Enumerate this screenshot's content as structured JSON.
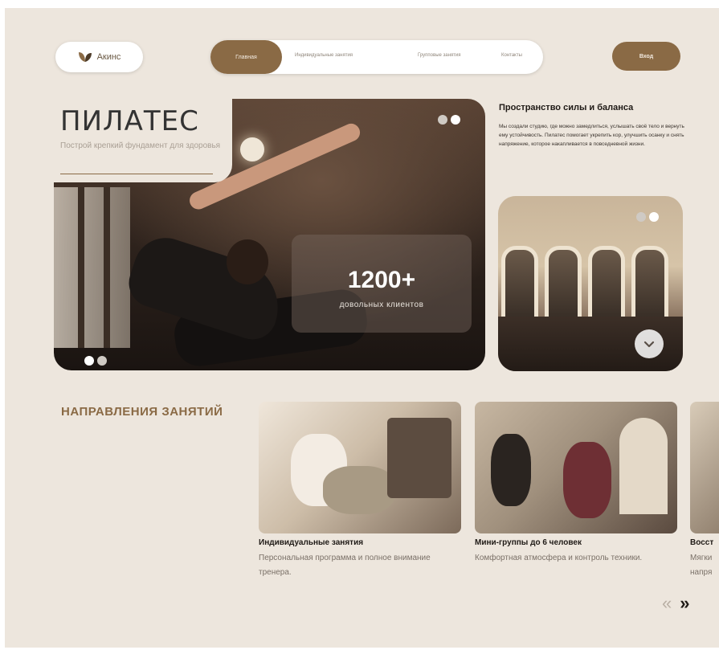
{
  "header": {
    "logo_text": "Акинс",
    "nav": {
      "items": [
        "Главная",
        "Индивидуальные занятия",
        "Групповые занятия",
        "Контакты"
      ],
      "active_index": 0
    },
    "login_label": "Вход"
  },
  "hero": {
    "title": "ПИЛАТЕС",
    "subtitle": "Построй крепкий фундамент для здоровья",
    "stat_value": "1200+",
    "stat_label": "довольных клиентов"
  },
  "about": {
    "title": "Пространство силы и баланса",
    "text": "Мы создали студию, где можно замедлиться, услышать своё тело и вернуть ему устойчивость. Пилатес помогает укрепить кор, улучшить осанку и снять напряжение, которое накапливается в повседневной жизни."
  },
  "directions": {
    "title": "НАПРАВЛЕНИЯ ЗАНЯТИЙ",
    "cards": [
      {
        "title": "Индивидуальные занятия",
        "desc": "Персональная программа и полное внимание тренера."
      },
      {
        "title": "Мини-группы до 6 человек",
        "desc": "Комфортная атмосфера и контроль техники."
      },
      {
        "title": "Восст",
        "desc": "Мягки напря"
      }
    ],
    "prev_label": "«",
    "next_label": "»"
  },
  "colors": {
    "background": "#ede6dd",
    "accent": "#8a6a45",
    "text_dark": "#1f1a16"
  },
  "icons": [
    "leaf-logo-icon",
    "slider-dot-icon",
    "chevron-down-icon",
    "arrow-prev-icon",
    "arrow-next-icon"
  ]
}
